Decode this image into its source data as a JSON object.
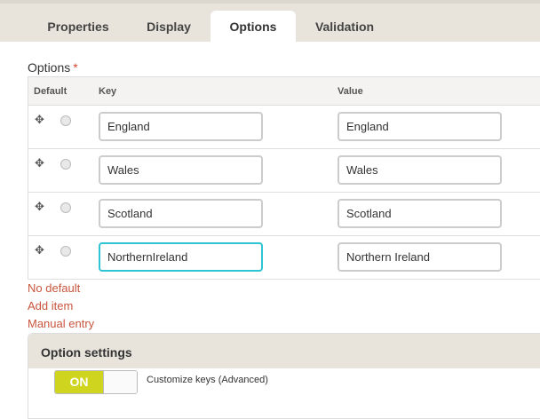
{
  "tabs": [
    {
      "label": "Properties"
    },
    {
      "label": "Display"
    },
    {
      "label": "Options"
    },
    {
      "label": "Validation"
    }
  ],
  "field": {
    "label": "Options",
    "required_mark": "*"
  },
  "grid": {
    "headers": {
      "default": "Default",
      "key": "Key",
      "value": "Value"
    },
    "rows": [
      {
        "key": "England",
        "value": "England"
      },
      {
        "key": "Wales",
        "value": "Wales"
      },
      {
        "key": "Scotland",
        "value": "Scotland"
      },
      {
        "key": "NorthernIreland",
        "value": "Northern Ireland"
      }
    ]
  },
  "links": {
    "no_default": "No default",
    "add_item": "Add item",
    "manual_entry": "Manual entry"
  },
  "settings": {
    "title": "Option settings",
    "toggle_label": "ON",
    "toggle_description": "Customize keys (Advanced)"
  },
  "colors": {
    "accent": "#cfd51f",
    "link": "#c8553d",
    "focus": "#2ec4d4"
  }
}
